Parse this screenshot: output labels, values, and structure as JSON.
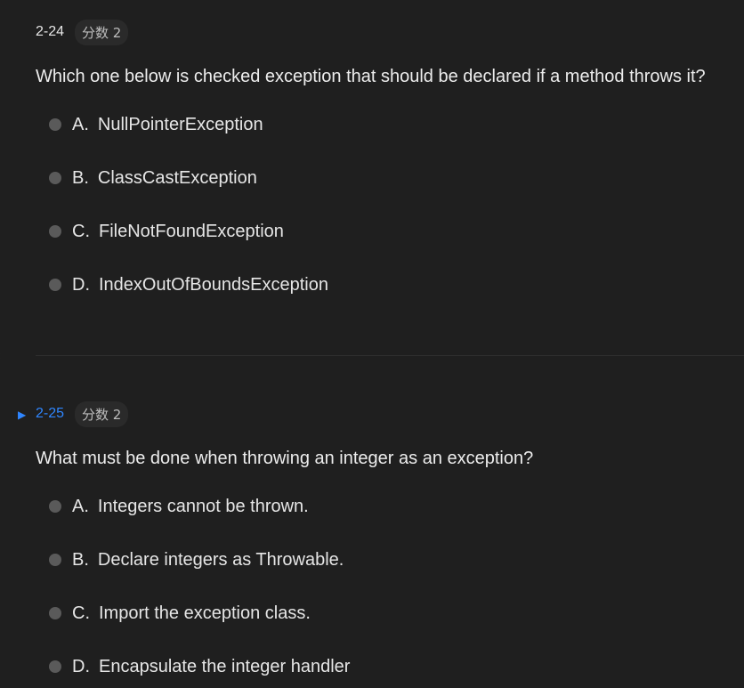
{
  "questions": [
    {
      "number": "2-24",
      "score": "分数 2",
      "text": "Which one below is checked exception that should be declared if a method throws it?",
      "options": [
        {
          "letter": "A.",
          "text": "NullPointerException"
        },
        {
          "letter": "B.",
          "text": "ClassCastException"
        },
        {
          "letter": "C.",
          "text": "FileNotFoundException"
        },
        {
          "letter": "D.",
          "text": "IndexOutOfBoundsException"
        }
      ]
    },
    {
      "number": "2-25",
      "score": "分数 2",
      "text": "What must be done when throwing an integer as an exception?",
      "options": [
        {
          "letter": "A.",
          "text": "Integers cannot be thrown."
        },
        {
          "letter": "B.",
          "text": "Declare integers as Throwable."
        },
        {
          "letter": "C.",
          "text": "Import the exception class."
        },
        {
          "letter": "D.",
          "text": "Encapsulate the integer handler"
        }
      ]
    }
  ],
  "icons": {
    "current_marker": "triangle-right-icon",
    "side_toggle": "chevron-left-icon"
  },
  "colors": {
    "background": "#1f1f1f",
    "accent": "#2f86ff",
    "text": "#e6e6e6"
  }
}
